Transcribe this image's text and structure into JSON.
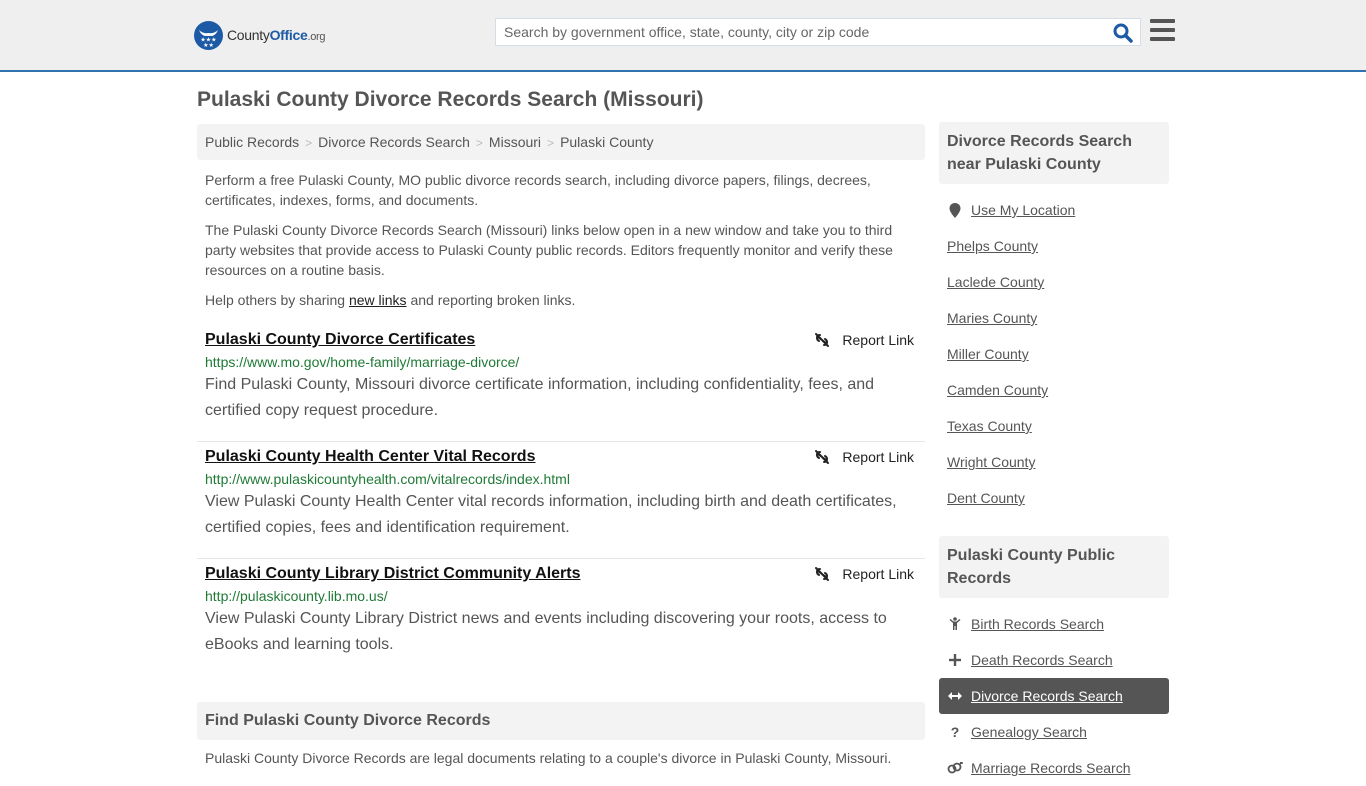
{
  "header": {
    "logo": {
      "part1": "County",
      "part2": "Office",
      "part3": ".org"
    },
    "search_placeholder": "Search by government office, state, county, city or zip code",
    "search_icon": "search-icon",
    "menu_icon": "hamburger-menu-icon"
  },
  "page_title": "Pulaski County Divorce Records Search (Missouri)",
  "breadcrumb": [
    "Public Records",
    "Divorce Records Search",
    "Missouri",
    "Pulaski County"
  ],
  "breadcrumb_separator": ">",
  "intro": {
    "p1": "Perform a free Pulaski County, MO public divorce records search, including divorce papers, filings, decrees, certificates, indexes, forms, and documents.",
    "p2": "The Pulaski County Divorce Records Search (Missouri) links below open in a new window and take you to third party websites that provide access to Pulaski County public records. Editors frequently monitor and verify these resources on a routine basis.",
    "p3_before": "Help others by sharing ",
    "p3_link": "new links",
    "p3_after": " and reporting broken links."
  },
  "links": [
    {
      "title": "Pulaski County Divorce Certificates",
      "url": "https://www.mo.gov/home-family/marriage-divorce/",
      "description": "Find Pulaski County, Missouri divorce certificate information, including confidentiality, fees, and certified copy request procedure.",
      "report_label": "Report Link"
    },
    {
      "title": "Pulaski County Health Center Vital Records",
      "url": "http://www.pulaskicountyhealth.com/vitalrecords/index.html",
      "description": "View Pulaski County Health Center vital records information, including birth and death certificates, certified copies, fees and identification requirement.",
      "report_label": "Report Link"
    },
    {
      "title": "Pulaski County Library District Community Alerts",
      "url": "http://pulaskicounty.lib.mo.us/",
      "description": "View Pulaski County Library District news and events including discovering your roots, access to eBooks and learning tools.",
      "report_label": "Report Link"
    }
  ],
  "find_section": {
    "heading": "Find Pulaski County Divorce Records",
    "text": "Pulaski County Divorce Records are legal documents relating to a couple's divorce in Pulaski County, Missouri."
  },
  "sidebar": {
    "near_heading": "Divorce Records Search near Pulaski County",
    "use_location": "Use My Location",
    "nearby": [
      "Phelps County",
      "Laclede County",
      "Maries County",
      "Miller County",
      "Camden County",
      "Texas County",
      "Wright County",
      "Dent County"
    ],
    "records_heading": "Pulaski County Public Records",
    "records": [
      {
        "label": "Birth Records Search",
        "icon": "child-icon",
        "glyph": "Ὣ8"
      },
      {
        "label": "Death Records Search",
        "icon": "plus-icon",
        "glyph": "+"
      },
      {
        "label": "Divorce Records Search",
        "icon": "arrows-horizontal-icon",
        "glyph": "↔",
        "active": true
      },
      {
        "label": "Genealogy Search",
        "icon": "question-icon",
        "glyph": "?"
      },
      {
        "label": "Marriage Records Search",
        "icon": "marriage-icon",
        "glyph": "⚤"
      }
    ]
  },
  "colors": {
    "brand_blue": "#1d5aa6",
    "header_border": "#2f74b1",
    "url_green": "#1f7a36",
    "active_bg": "#555555"
  }
}
